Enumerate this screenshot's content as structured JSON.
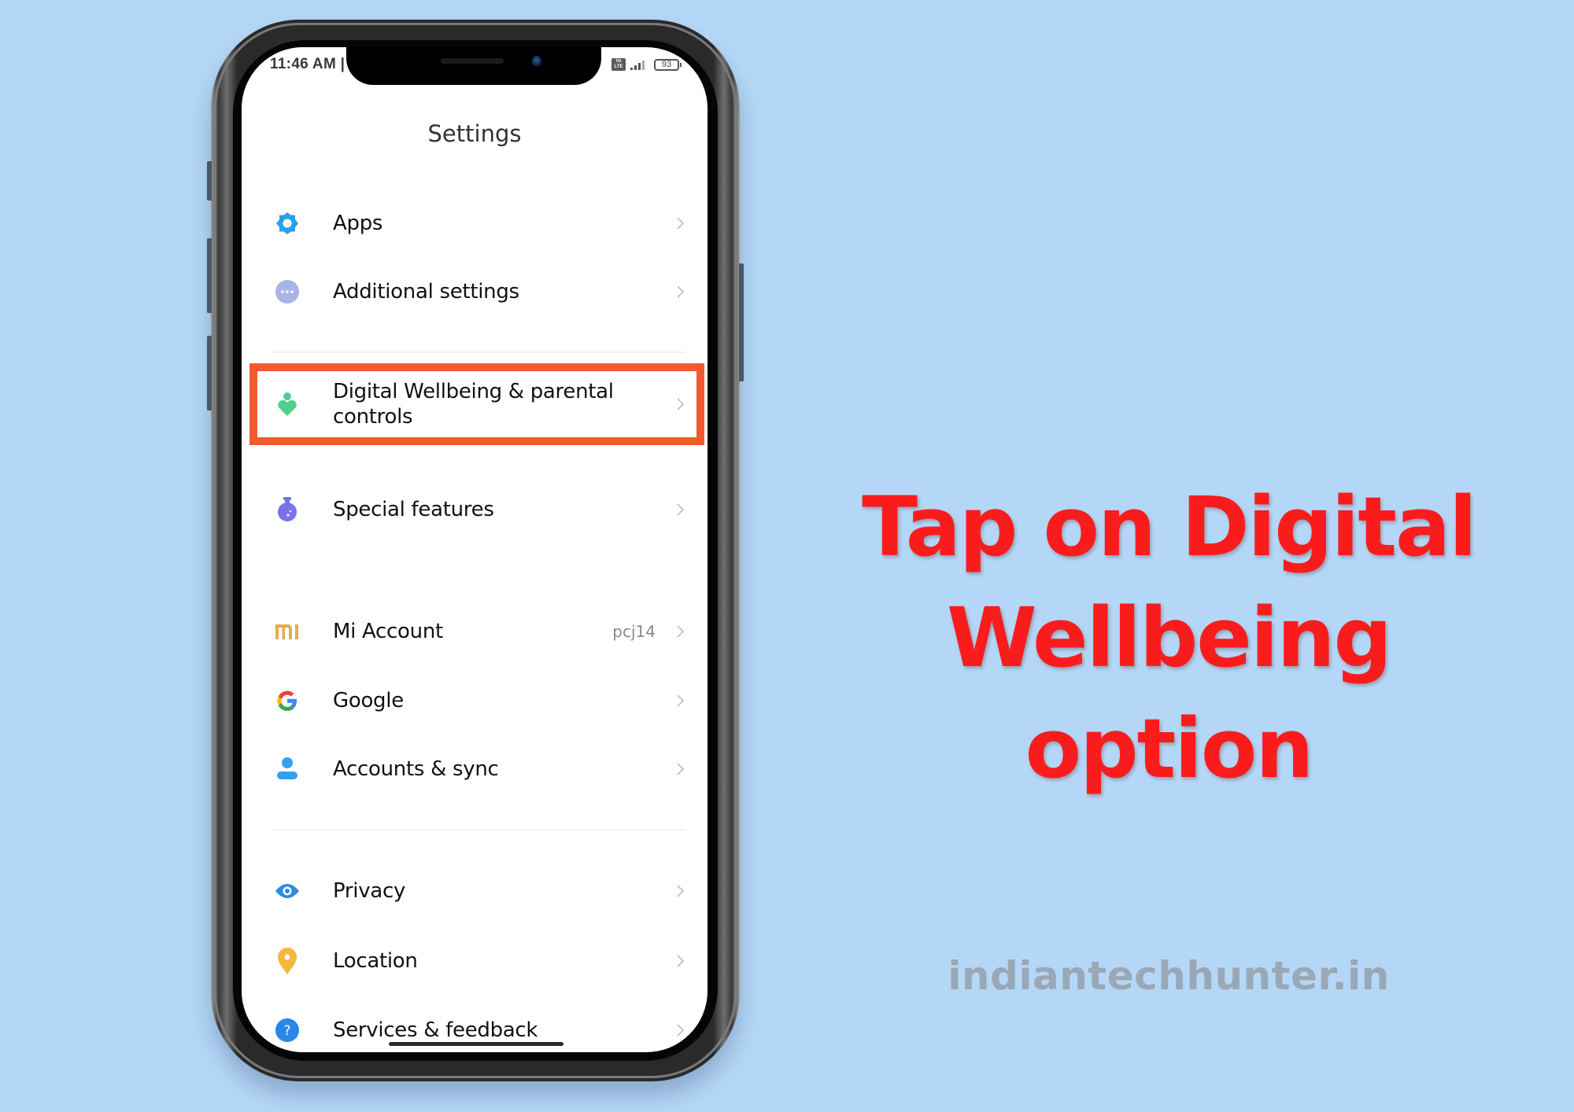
{
  "status_bar": {
    "time": "11:46 AM | ",
    "network_badge": "Vo LTE",
    "battery_level": "93"
  },
  "header": {
    "title": "Settings"
  },
  "settings_items": [
    {
      "label": "Apps",
      "icon": "gear-icon",
      "icon_color": "#2f9ee8"
    },
    {
      "label": "Additional settings",
      "icon": "more-dots-icon",
      "icon_color": "#a9b4e6"
    },
    {
      "label": "Digital Wellbeing & parental controls",
      "icon": "wellbeing-heart-person-icon",
      "icon_color": "#4fd08c",
      "highlighted": true
    },
    {
      "label": "Special features",
      "icon": "flask-icon",
      "icon_color": "#7a72ea"
    },
    {
      "label": "Mi Account",
      "icon": "mi-logo-icon",
      "icon_color": "#e9a94a",
      "value": "pcj14"
    },
    {
      "label": "Google",
      "icon": "google-g-icon",
      "icon_color": "#4285f4"
    },
    {
      "label": "Accounts & sync",
      "icon": "person-icon",
      "icon_color": "#34a0f0"
    },
    {
      "label": "Privacy",
      "icon": "eye-icon",
      "icon_color": "#2a8de0"
    },
    {
      "label": "Location",
      "icon": "location-pin-icon",
      "icon_color": "#f6b740"
    },
    {
      "label": "Services & feedback",
      "icon": "question-icon",
      "icon_color": "#2a86e8"
    }
  ],
  "highlight_color": "#f15a30",
  "instruction": {
    "line1": "Tap on Digital",
    "line2": "Wellbeing option",
    "color": "#fa1c1c"
  },
  "watermark": "indiantechhunter.in"
}
